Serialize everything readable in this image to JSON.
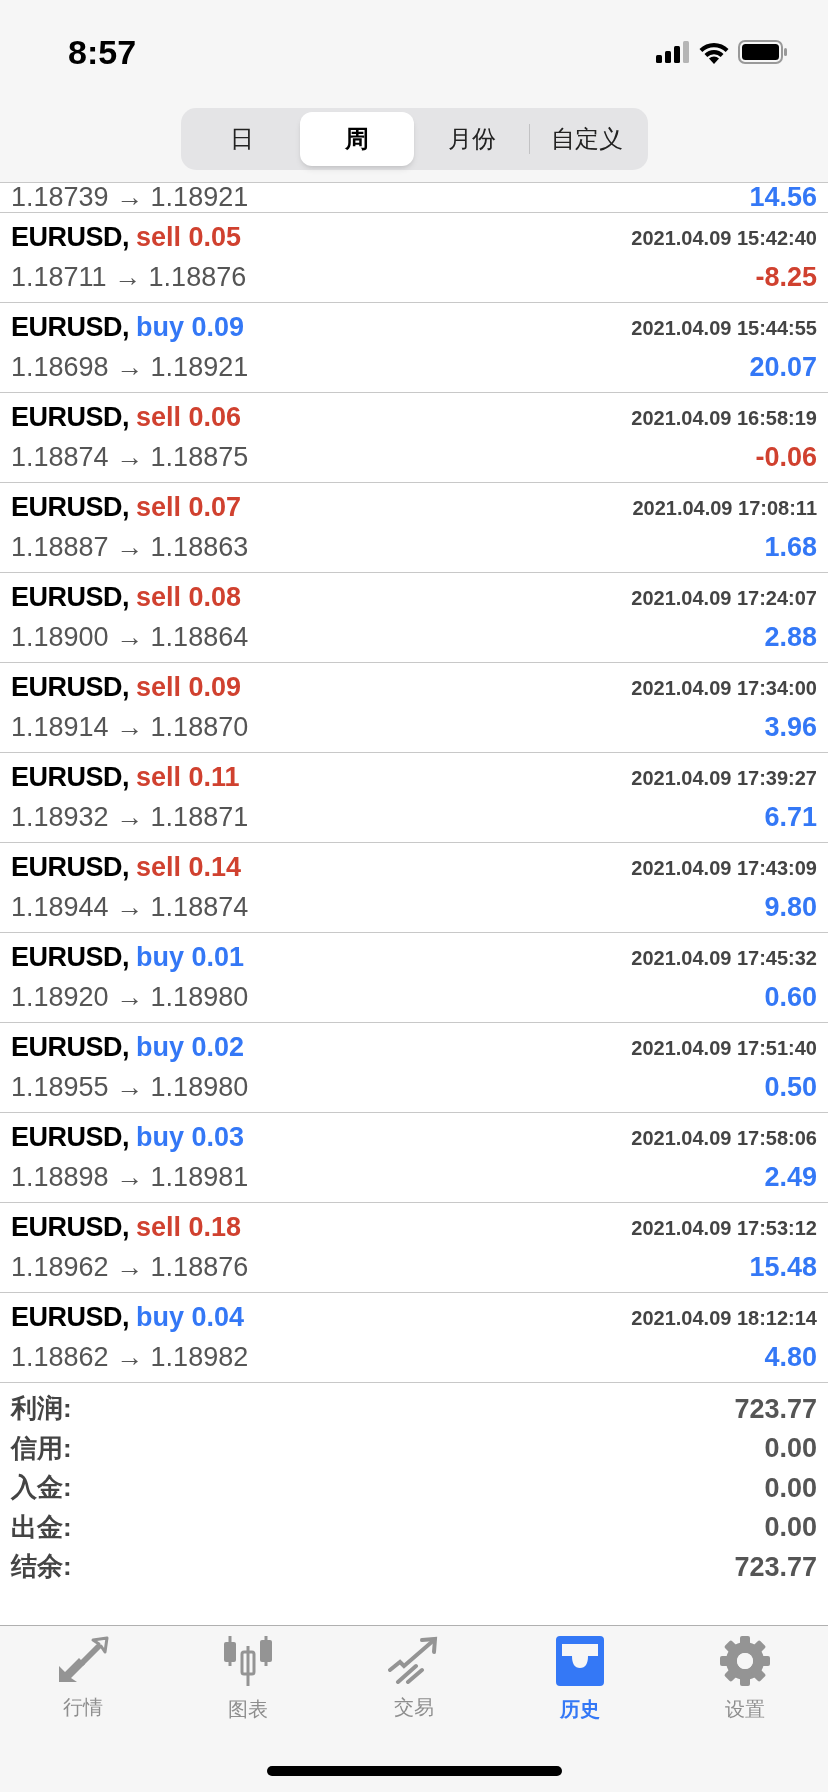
{
  "status_bar": {
    "time": "8:57"
  },
  "period_tabs": [
    {
      "label": "日",
      "selected": false
    },
    {
      "label": "周",
      "selected": true
    },
    {
      "label": "月份",
      "selected": false
    },
    {
      "label": "自定义",
      "selected": false
    }
  ],
  "partial_row": {
    "prices": "1.18739 → 1.18921",
    "profit": "14.56",
    "negative": false
  },
  "deals": [
    {
      "symbol": "EURUSD,",
      "order": "sell 0.05",
      "kind": "sell",
      "time": "2021.04.09 15:42:40",
      "prices": "1.18711 → 1.18876",
      "profit": "-8.25",
      "negative": true
    },
    {
      "symbol": "EURUSD,",
      "order": "buy 0.09",
      "kind": "buy",
      "time": "2021.04.09 15:44:55",
      "prices": "1.18698 → 1.18921",
      "profit": "20.07",
      "negative": false
    },
    {
      "symbol": "EURUSD,",
      "order": "sell 0.06",
      "kind": "sell",
      "time": "2021.04.09 16:58:19",
      "prices": "1.18874 → 1.18875",
      "profit": "-0.06",
      "negative": true
    },
    {
      "symbol": "EURUSD,",
      "order": "sell 0.07",
      "kind": "sell",
      "time": "2021.04.09 17:08:11",
      "prices": "1.18887 → 1.18863",
      "profit": "1.68",
      "negative": false
    },
    {
      "symbol": "EURUSD,",
      "order": "sell 0.08",
      "kind": "sell",
      "time": "2021.04.09 17:24:07",
      "prices": "1.18900 → 1.18864",
      "profit": "2.88",
      "negative": false
    },
    {
      "symbol": "EURUSD,",
      "order": "sell 0.09",
      "kind": "sell",
      "time": "2021.04.09 17:34:00",
      "prices": "1.18914 → 1.18870",
      "profit": "3.96",
      "negative": false
    },
    {
      "symbol": "EURUSD,",
      "order": "sell 0.11",
      "kind": "sell",
      "time": "2021.04.09 17:39:27",
      "prices": "1.18932 → 1.18871",
      "profit": "6.71",
      "negative": false
    },
    {
      "symbol": "EURUSD,",
      "order": "sell 0.14",
      "kind": "sell",
      "time": "2021.04.09 17:43:09",
      "prices": "1.18944 → 1.18874",
      "profit": "9.80",
      "negative": false
    },
    {
      "symbol": "EURUSD,",
      "order": "buy 0.01",
      "kind": "buy",
      "time": "2021.04.09 17:45:32",
      "prices": "1.18920 → 1.18980",
      "profit": "0.60",
      "negative": false
    },
    {
      "symbol": "EURUSD,",
      "order": "buy 0.02",
      "kind": "buy",
      "time": "2021.04.09 17:51:40",
      "prices": "1.18955 → 1.18980",
      "profit": "0.50",
      "negative": false
    },
    {
      "symbol": "EURUSD,",
      "order": "buy 0.03",
      "kind": "buy",
      "time": "2021.04.09 17:58:06",
      "prices": "1.18898 → 1.18981",
      "profit": "2.49",
      "negative": false
    },
    {
      "symbol": "EURUSD,",
      "order": "sell 0.18",
      "kind": "sell",
      "time": "2021.04.09 17:53:12",
      "prices": "1.18962 → 1.18876",
      "profit": "15.48",
      "negative": false
    },
    {
      "symbol": "EURUSD,",
      "order": "buy 0.04",
      "kind": "buy",
      "time": "2021.04.09 18:12:14",
      "prices": "1.18862 → 1.18982",
      "profit": "4.80",
      "negative": false
    }
  ],
  "summary": [
    {
      "label": "利润:",
      "value": "723.77"
    },
    {
      "label": "信用:",
      "value": "0.00"
    },
    {
      "label": "入金:",
      "value": "0.00"
    },
    {
      "label": "出金:",
      "value": "0.00"
    },
    {
      "label": "结余:",
      "value": "723.77"
    }
  ],
  "tab_bar": [
    {
      "kind": "quotes",
      "label": "行情",
      "selected": false
    },
    {
      "kind": "chart",
      "label": "图表",
      "selected": false
    },
    {
      "kind": "trade",
      "label": "交易",
      "selected": false
    },
    {
      "kind": "history",
      "label": "历史",
      "selected": true
    },
    {
      "kind": "settings",
      "label": "设置",
      "selected": false
    }
  ]
}
